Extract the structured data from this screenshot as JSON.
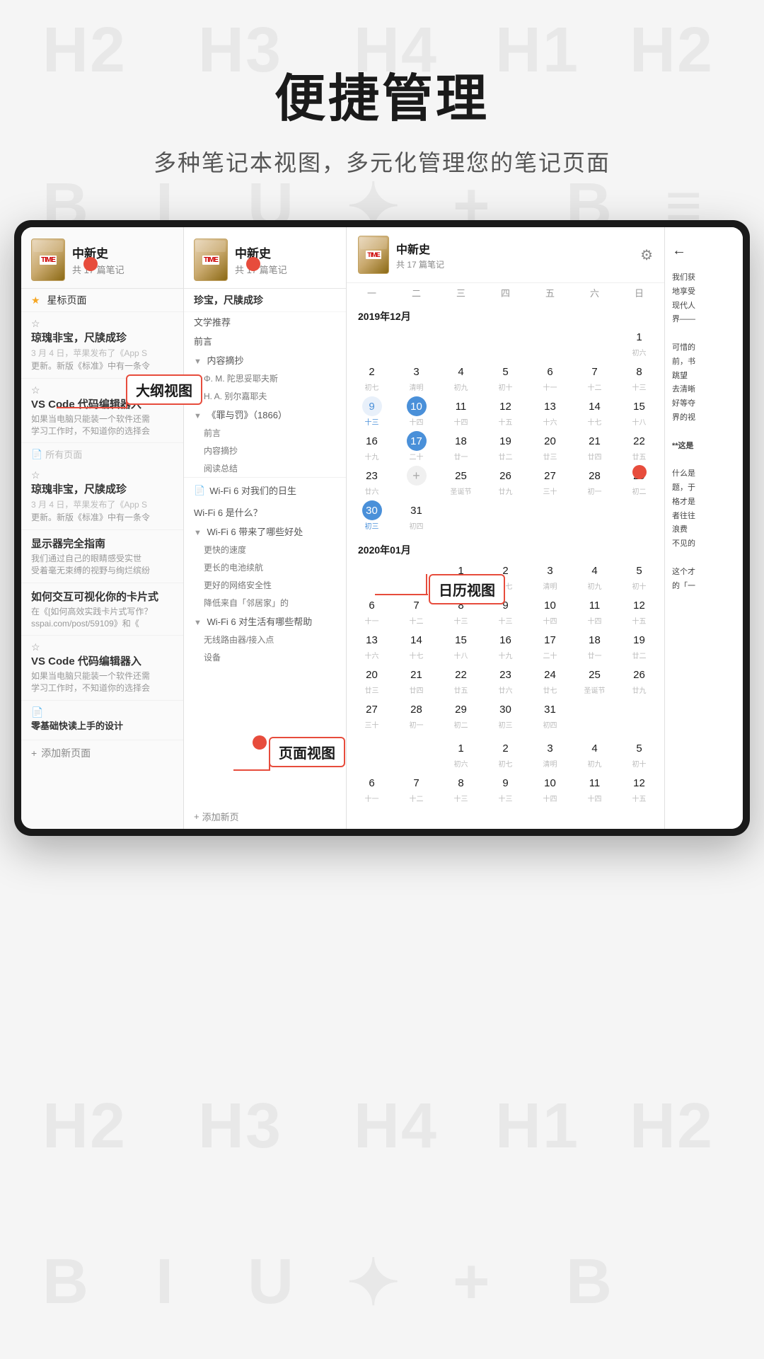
{
  "page": {
    "main_title": "便捷管理",
    "sub_title": "多种笔记本视图，多元化管理您的笔记页面"
  },
  "notebook": {
    "name": "中新史",
    "count_text": "共 17 篇笔记",
    "time_logo": "TIME"
  },
  "watermark_chars": [
    "H2",
    "H3",
    "H4",
    "H1",
    "H2",
    "B",
    "I",
    "U",
    "+",
    "B"
  ],
  "annotations": {
    "outline_view": "大纲视图",
    "calendar_view": "日历视图",
    "page_view": "页面视图"
  },
  "list_items": [
    {
      "type": "star",
      "title": "星标页面"
    },
    {
      "type": "page",
      "title": "琼瑰非宝，尺牍成珍",
      "meta": "",
      "preview": "3 月 4 日，苹果发布了《App S 更新。新版《标准》中有一条令"
    },
    {
      "type": "page",
      "title": "VS Code 代码编辑器入",
      "preview": "如果当电脑只能装一个软件还需 学习工作时，不知道你的选择会"
    },
    {
      "type": "separator",
      "title": "所有页面"
    },
    {
      "type": "page",
      "title": "琼瑰非宝，尺牍成珍",
      "preview": "3 月 4 日，苹果发布了《App S 更新。新版《标准》中有一条令"
    },
    {
      "type": "page",
      "title": "显示器完全指南",
      "bold": true,
      "preview": "我们通过自己的眼睛感受实世 受着毫无束缚的视野与绚烂缤纷"
    },
    {
      "type": "page",
      "title": "如何交互可视化你的卡片式",
      "bold": true,
      "preview": "在《[如何高效实践卡片式写作？ sspai.com/post/59109》和《"
    },
    {
      "type": "page",
      "title": "VS Code 代码编辑器入",
      "preview": "如果当电脑只能装一个软件还需 学习工作时，不知道你的选择会"
    },
    {
      "type": "page",
      "title": "零基础快读上手的设计"
    }
  ],
  "outline_items": [
    {
      "indent": 0,
      "type": "cover",
      "text": "珍宝，尺牍成珍"
    },
    {
      "indent": 0,
      "text": "文学推荐"
    },
    {
      "indent": 0,
      "text": "前言"
    },
    {
      "indent": 1,
      "collapse": true,
      "text": "内容摘抄"
    },
    {
      "indent": 2,
      "text": "Φ. M. 陀思妥耶夫斯"
    },
    {
      "indent": 2,
      "text": "H. A. 别尔嘉耶夫"
    },
    {
      "indent": 1,
      "collapse": true,
      "text": "《罪与罚》（1866）"
    },
    {
      "indent": 2,
      "text": "前言"
    },
    {
      "indent": 2,
      "text": "内容摘抄"
    },
    {
      "indent": 2,
      "text": "阅读总结"
    },
    {
      "indent": 0,
      "file": true,
      "text": "Wi-Fi 6 对我们的日生"
    },
    {
      "indent": 0,
      "text": "Wi-Fi 6 是什么？"
    },
    {
      "indent": 1,
      "collapse": true,
      "text": "Wi-Fi 6 带来了哪些好处"
    },
    {
      "indent": 2,
      "text": "更快的速度"
    },
    {
      "indent": 2,
      "text": "更长的电池续航"
    },
    {
      "indent": 2,
      "text": "更好的网络安全性"
    },
    {
      "indent": 2,
      "text": "降低来自「邻居家」的"
    },
    {
      "indent": 1,
      "collapse": true,
      "text": "Wi-Fi 6 对生活有哪些帮助"
    },
    {
      "indent": 2,
      "text": "无线路由器/接入点"
    },
    {
      "indent": 2,
      "text": "设备"
    },
    {
      "indent": 0,
      "add": true,
      "text": "+ 添加新页"
    }
  ],
  "calendar": {
    "months": [
      {
        "label": "2019年12月",
        "weekdays": [
          "一",
          "二",
          "三",
          "四",
          "五",
          "六",
          "日"
        ],
        "days": [
          {
            "num": "",
            "lunar": ""
          },
          {
            "num": "",
            "lunar": ""
          },
          {
            "num": "",
            "lunar": ""
          },
          {
            "num": "",
            "lunar": ""
          },
          {
            "num": "",
            "lunar": ""
          },
          {
            "num": "",
            "lunar": ""
          },
          {
            "num": "1",
            "lunar": "初六"
          },
          {
            "num": "2",
            "lunar": "初七"
          },
          {
            "num": "3",
            "lunar": "清明"
          },
          {
            "num": "4",
            "lunar": "初九"
          },
          {
            "num": "5",
            "lunar": "初十"
          },
          {
            "num": "6",
            "lunar": "十一"
          },
          {
            "num": "7",
            "lunar": "十二"
          },
          {
            "num": "8",
            "lunar": "十三"
          },
          {
            "num": "9",
            "lunar": "十三",
            "highlight": true
          },
          {
            "num": "10",
            "lunar": "十四",
            "today": true
          },
          {
            "num": "11",
            "lunar": "十四"
          },
          {
            "num": "12",
            "lunar": "十五"
          },
          {
            "num": "13",
            "lunar": "十六"
          },
          {
            "num": "14",
            "lunar": "十七"
          },
          {
            "num": "15",
            "lunar": "十八"
          },
          {
            "num": "16",
            "lunar": "十九"
          },
          {
            "num": "17",
            "lunar": "二十",
            "today2": true
          },
          {
            "num": "18",
            "lunar": "廿一"
          },
          {
            "num": "19",
            "lunar": "廿二"
          },
          {
            "num": "20",
            "lunar": "廿三"
          },
          {
            "num": "21",
            "lunar": "廿四"
          },
          {
            "num": "22",
            "lunar": "廿五"
          },
          {
            "num": "23",
            "lunar": "廿六"
          },
          {
            "num": "24",
            "lunar": "廿七"
          },
          {
            "num": "25",
            "lunar": "圣诞节"
          },
          {
            "num": "26",
            "lunar": "廿九"
          },
          {
            "num": "27",
            "lunar": "三十"
          },
          {
            "num": "28",
            "lunar": "初一"
          },
          {
            "num": "29",
            "lunar": "初二"
          },
          {
            "num": "30",
            "lunar": "初三",
            "blue": true
          },
          {
            "num": "31",
            "lunar": "初四"
          },
          {
            "num": "+",
            "lunar": ""
          }
        ]
      },
      {
        "label": "2020年01月",
        "days": [
          {
            "num": "",
            "lunar": ""
          },
          {
            "num": "",
            "lunar": ""
          },
          {
            "num": "1",
            "lunar": "初六"
          },
          {
            "num": "2",
            "lunar": "初七"
          },
          {
            "num": "3",
            "lunar": "清明"
          },
          {
            "num": "4",
            "lunar": "初九"
          },
          {
            "num": "5",
            "lunar": "初十"
          },
          {
            "num": "6",
            "lunar": "十一"
          },
          {
            "num": "7",
            "lunar": "十二"
          },
          {
            "num": "8",
            "lunar": "十三"
          },
          {
            "num": "9",
            "lunar": "十三"
          },
          {
            "num": "10",
            "lunar": "十四"
          },
          {
            "num": "11",
            "lunar": "十四"
          },
          {
            "num": "12",
            "lunar": "十五"
          },
          {
            "num": "13",
            "lunar": "十六"
          },
          {
            "num": "14",
            "lunar": "十七"
          },
          {
            "num": "15",
            "lunar": "十八"
          },
          {
            "num": "16",
            "lunar": "十九"
          },
          {
            "num": "17",
            "lunar": "二十"
          },
          {
            "num": "18",
            "lunar": "廿一"
          },
          {
            "num": "19",
            "lunar": "廿二"
          },
          {
            "num": "20",
            "lunar": "廿三"
          },
          {
            "num": "21",
            "lunar": "廿四"
          },
          {
            "num": "22",
            "lunar": "廿五"
          },
          {
            "num": "23",
            "lunar": "廿六"
          },
          {
            "num": "24",
            "lunar": "廿七"
          },
          {
            "num": "25",
            "lunar": "圣诞节"
          },
          {
            "num": "26",
            "lunar": "廿九"
          },
          {
            "num": "27",
            "lunar": "三十"
          },
          {
            "num": "28",
            "lunar": "初一"
          },
          {
            "num": "29",
            "lunar": "初二"
          },
          {
            "num": "30",
            "lunar": "初三"
          },
          {
            "num": "31",
            "lunar": "初四"
          },
          {
            "num": "",
            "lunar": ""
          },
          {
            "num": "",
            "lunar": ""
          },
          {
            "num": "1",
            "lunar": "初六"
          },
          {
            "num": "2",
            "lunar": "初七"
          },
          {
            "num": "3",
            "lunar": "清明"
          },
          {
            "num": "4",
            "lunar": "初九"
          },
          {
            "num": "5",
            "lunar": "初十"
          },
          {
            "num": "6",
            "lunar": "十一"
          },
          {
            "num": "7",
            "lunar": "十二"
          },
          {
            "num": "8",
            "lunar": "十三"
          },
          {
            "num": "9",
            "lunar": "十三"
          },
          {
            "num": "10",
            "lunar": "十四"
          },
          {
            "num": "11",
            "lunar": "十四"
          },
          {
            "num": "12",
            "lunar": "十五"
          }
        ]
      }
    ]
  },
  "reading_text": {
    "lines": [
      "我们获",
      "地享受",
      "现代人",
      "界——",
      "",
      "可惜的",
      "前，书",
      "跳望",
      "去清晰",
      "好等夺",
      "界的视",
      "",
      "**这是",
      "",
      "什么是",
      "题，于",
      "格才是",
      "者往往",
      "浪费",
      "不见的"
    ]
  }
}
